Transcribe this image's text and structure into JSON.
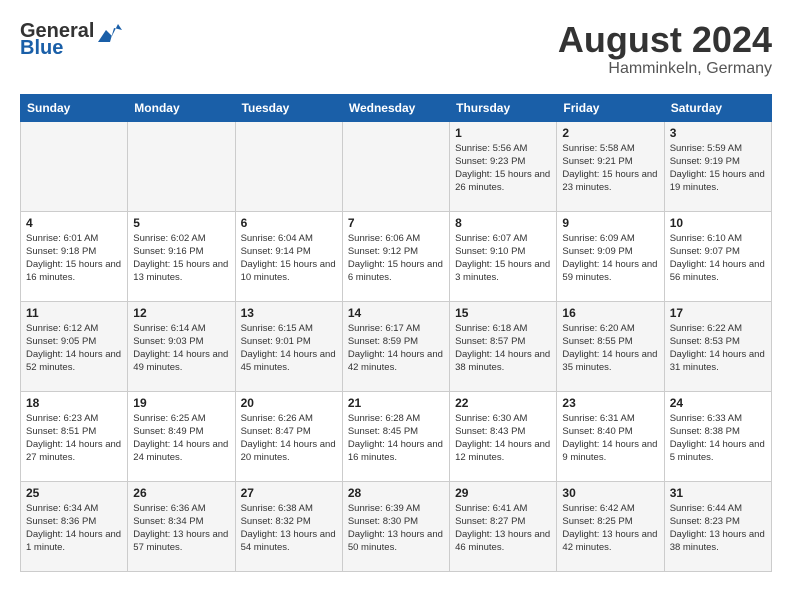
{
  "header": {
    "logo_general": "General",
    "logo_blue": "Blue",
    "title": "August 2024",
    "subtitle": "Hamminkeln, Germany"
  },
  "calendar": {
    "days_of_week": [
      "Sunday",
      "Monday",
      "Tuesday",
      "Wednesday",
      "Thursday",
      "Friday",
      "Saturday"
    ],
    "weeks": [
      [
        {
          "day": "",
          "content": ""
        },
        {
          "day": "",
          "content": ""
        },
        {
          "day": "",
          "content": ""
        },
        {
          "day": "",
          "content": ""
        },
        {
          "day": "1",
          "content": "Sunrise: 5:56 AM\nSunset: 9:23 PM\nDaylight: 15 hours and 26 minutes."
        },
        {
          "day": "2",
          "content": "Sunrise: 5:58 AM\nSunset: 9:21 PM\nDaylight: 15 hours and 23 minutes."
        },
        {
          "day": "3",
          "content": "Sunrise: 5:59 AM\nSunset: 9:19 PM\nDaylight: 15 hours and 19 minutes."
        }
      ],
      [
        {
          "day": "4",
          "content": "Sunrise: 6:01 AM\nSunset: 9:18 PM\nDaylight: 15 hours and 16 minutes."
        },
        {
          "day": "5",
          "content": "Sunrise: 6:02 AM\nSunset: 9:16 PM\nDaylight: 15 hours and 13 minutes."
        },
        {
          "day": "6",
          "content": "Sunrise: 6:04 AM\nSunset: 9:14 PM\nDaylight: 15 hours and 10 minutes."
        },
        {
          "day": "7",
          "content": "Sunrise: 6:06 AM\nSunset: 9:12 PM\nDaylight: 15 hours and 6 minutes."
        },
        {
          "day": "8",
          "content": "Sunrise: 6:07 AM\nSunset: 9:10 PM\nDaylight: 15 hours and 3 minutes."
        },
        {
          "day": "9",
          "content": "Sunrise: 6:09 AM\nSunset: 9:09 PM\nDaylight: 14 hours and 59 minutes."
        },
        {
          "day": "10",
          "content": "Sunrise: 6:10 AM\nSunset: 9:07 PM\nDaylight: 14 hours and 56 minutes."
        }
      ],
      [
        {
          "day": "11",
          "content": "Sunrise: 6:12 AM\nSunset: 9:05 PM\nDaylight: 14 hours and 52 minutes."
        },
        {
          "day": "12",
          "content": "Sunrise: 6:14 AM\nSunset: 9:03 PM\nDaylight: 14 hours and 49 minutes."
        },
        {
          "day": "13",
          "content": "Sunrise: 6:15 AM\nSunset: 9:01 PM\nDaylight: 14 hours and 45 minutes."
        },
        {
          "day": "14",
          "content": "Sunrise: 6:17 AM\nSunset: 8:59 PM\nDaylight: 14 hours and 42 minutes."
        },
        {
          "day": "15",
          "content": "Sunrise: 6:18 AM\nSunset: 8:57 PM\nDaylight: 14 hours and 38 minutes."
        },
        {
          "day": "16",
          "content": "Sunrise: 6:20 AM\nSunset: 8:55 PM\nDaylight: 14 hours and 35 minutes."
        },
        {
          "day": "17",
          "content": "Sunrise: 6:22 AM\nSunset: 8:53 PM\nDaylight: 14 hours and 31 minutes."
        }
      ],
      [
        {
          "day": "18",
          "content": "Sunrise: 6:23 AM\nSunset: 8:51 PM\nDaylight: 14 hours and 27 minutes."
        },
        {
          "day": "19",
          "content": "Sunrise: 6:25 AM\nSunset: 8:49 PM\nDaylight: 14 hours and 24 minutes."
        },
        {
          "day": "20",
          "content": "Sunrise: 6:26 AM\nSunset: 8:47 PM\nDaylight: 14 hours and 20 minutes."
        },
        {
          "day": "21",
          "content": "Sunrise: 6:28 AM\nSunset: 8:45 PM\nDaylight: 14 hours and 16 minutes."
        },
        {
          "day": "22",
          "content": "Sunrise: 6:30 AM\nSunset: 8:43 PM\nDaylight: 14 hours and 12 minutes."
        },
        {
          "day": "23",
          "content": "Sunrise: 6:31 AM\nSunset: 8:40 PM\nDaylight: 14 hours and 9 minutes."
        },
        {
          "day": "24",
          "content": "Sunrise: 6:33 AM\nSunset: 8:38 PM\nDaylight: 14 hours and 5 minutes."
        }
      ],
      [
        {
          "day": "25",
          "content": "Sunrise: 6:34 AM\nSunset: 8:36 PM\nDaylight: 14 hours and 1 minute."
        },
        {
          "day": "26",
          "content": "Sunrise: 6:36 AM\nSunset: 8:34 PM\nDaylight: 13 hours and 57 minutes."
        },
        {
          "day": "27",
          "content": "Sunrise: 6:38 AM\nSunset: 8:32 PM\nDaylight: 13 hours and 54 minutes."
        },
        {
          "day": "28",
          "content": "Sunrise: 6:39 AM\nSunset: 8:30 PM\nDaylight: 13 hours and 50 minutes."
        },
        {
          "day": "29",
          "content": "Sunrise: 6:41 AM\nSunset: 8:27 PM\nDaylight: 13 hours and 46 minutes."
        },
        {
          "day": "30",
          "content": "Sunrise: 6:42 AM\nSunset: 8:25 PM\nDaylight: 13 hours and 42 minutes."
        },
        {
          "day": "31",
          "content": "Sunrise: 6:44 AM\nSunset: 8:23 PM\nDaylight: 13 hours and 38 minutes."
        }
      ]
    ]
  }
}
